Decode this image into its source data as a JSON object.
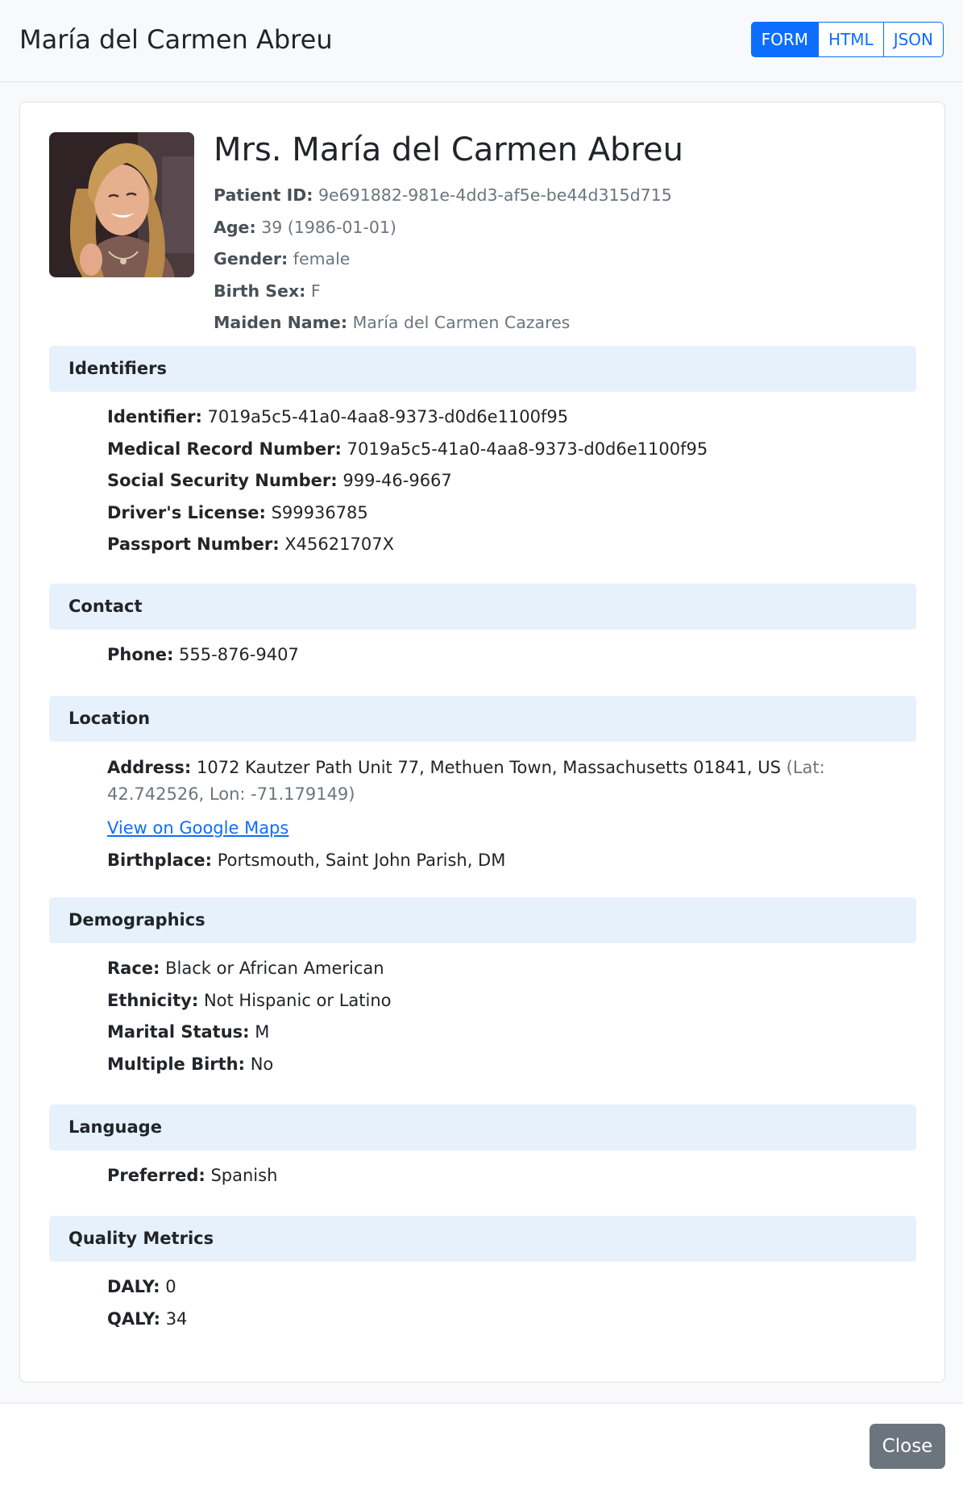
{
  "modal": {
    "title": "María del Carmen Abreu"
  },
  "view_toggle": {
    "form": "FORM",
    "html": "HTML",
    "json": "JSON",
    "active": "FORM"
  },
  "patient": {
    "full_name": "Mrs. María del Carmen Abreu",
    "avatar_icon": "patient-portrait",
    "id_label": "Patient ID:",
    "id": "9e691882-981e-4dd3-af5e-be44d315d715",
    "age_label": "Age:",
    "age": "39 (1986-01-01)",
    "gender_label": "Gender:",
    "gender": "female",
    "birth_sex_label": "Birth Sex:",
    "birth_sex": "F",
    "maiden_name_label": "Maiden Name:",
    "maiden_name": "María del Carmen Cazares"
  },
  "identifiers": {
    "heading": "Identifiers",
    "identifier_label": "Identifier:",
    "identifier": "7019a5c5-41a0-4aa8-9373-d0d6e1100f95",
    "mrn_label": "Medical Record Number:",
    "mrn": "7019a5c5-41a0-4aa8-9373-d0d6e1100f95",
    "ssn_label": "Social Security Number:",
    "ssn": "999-46-9667",
    "license_label": "Driver's License:",
    "license": "S99936785",
    "passport_label": "Passport Number:",
    "passport": "X45621707X"
  },
  "contact": {
    "heading": "Contact",
    "phone_label": "Phone:",
    "phone": "555-876-9407"
  },
  "location": {
    "heading": "Location",
    "address_label": "Address:",
    "address": "1072 Kautzer Path Unit 77, Methuen Town, Massachusetts 01841, US",
    "coords": "(Lat: 42.742526, Lon: -71.179149)",
    "maps_link": "View on Google Maps",
    "birthplace_label": "Birthplace:",
    "birthplace": "Portsmouth, Saint John Parish, DM"
  },
  "demographics": {
    "heading": "Demographics",
    "race_label": "Race:",
    "race": "Black or African American",
    "ethnicity_label": "Ethnicity:",
    "ethnicity": "Not Hispanic or Latino",
    "marital_label": "Marital Status:",
    "marital": "M",
    "multiple_birth_label": "Multiple Birth:",
    "multiple_birth": "No"
  },
  "language": {
    "heading": "Language",
    "preferred_label": "Preferred:",
    "preferred": "Spanish"
  },
  "quality": {
    "heading": "Quality Metrics",
    "daly_label": "DALY:",
    "daly": "0",
    "qaly_label": "QALY:",
    "qaly": "34"
  },
  "footer": {
    "close": "Close"
  },
  "colors": {
    "primary": "#0d6efd",
    "section_bg": "#e7f1fc",
    "secondary_button": "#6c757d",
    "muted_text": "#6c757d"
  }
}
